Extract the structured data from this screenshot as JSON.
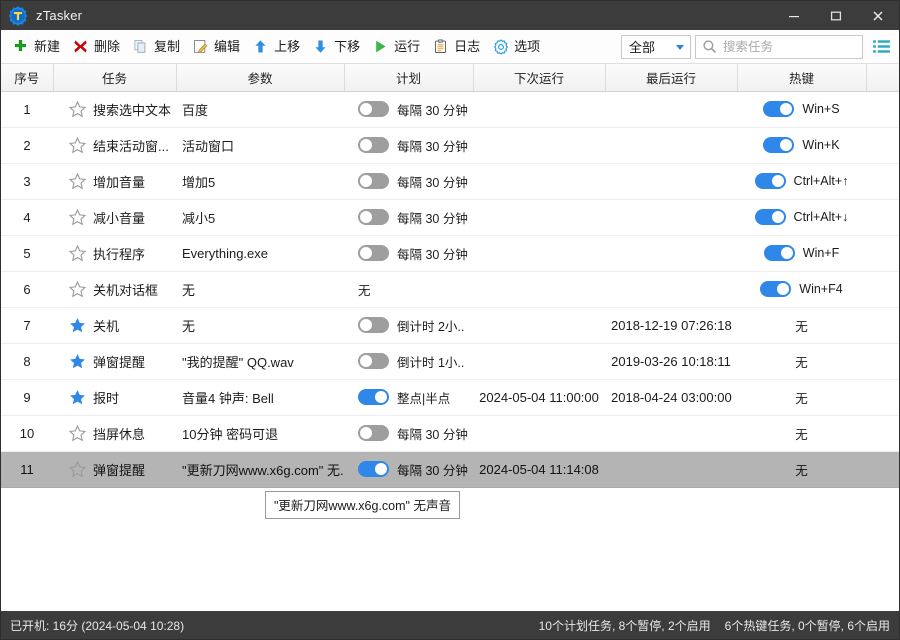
{
  "window": {
    "title": "zTasker",
    "app_icon": "gear-t-logo-icon",
    "minimize_label": "—",
    "maximize_label": "☐",
    "close_label": "✕"
  },
  "toolbar": {
    "items": [
      {
        "label": "新建",
        "icon": "plus-icon"
      },
      {
        "label": "删除",
        "icon": "delete-x-icon"
      },
      {
        "label": "复制",
        "icon": "copy-icon"
      },
      {
        "label": "编辑",
        "icon": "edit-pencil-icon"
      },
      {
        "label": "上移",
        "icon": "arrow-up-icon"
      },
      {
        "label": "下移",
        "icon": "arrow-down-icon"
      },
      {
        "label": "运行",
        "icon": "play-icon"
      },
      {
        "label": "日志",
        "icon": "clipboard-icon"
      },
      {
        "label": "选项",
        "icon": "gear-icon"
      }
    ],
    "filter": {
      "value": "全部",
      "icon": "chevron-down-icon"
    },
    "search": {
      "value": "",
      "placeholder": "搜索任务",
      "icon": "search-icon"
    },
    "list_view": {
      "icon": "list-view-icon"
    }
  },
  "table": {
    "columns": [
      "序号",
      "任务",
      "参数",
      "计划",
      "下次运行",
      "最后运行",
      "热键"
    ],
    "rows": [
      {
        "idx": "1",
        "star": "outline",
        "task": "搜索选中文本",
        "args": "百度",
        "plan_toggle": "off",
        "plan": "每隔 30 分钟",
        "next": "",
        "last": "",
        "hot_toggle": "on",
        "hotkey": "Win+S"
      },
      {
        "idx": "2",
        "star": "outline",
        "task": "结束活动窗...",
        "args": "活动窗口",
        "plan_toggle": "off",
        "plan": "每隔 30 分钟",
        "next": "",
        "last": "",
        "hot_toggle": "on",
        "hotkey": "Win+K"
      },
      {
        "idx": "3",
        "star": "outline",
        "task": "增加音量",
        "args": "增加5",
        "plan_toggle": "off",
        "plan": "每隔 30 分钟",
        "next": "",
        "last": "",
        "hot_toggle": "on",
        "hotkey": "Ctrl+Alt+↑"
      },
      {
        "idx": "4",
        "star": "outline",
        "task": "减小音量",
        "args": "减小5",
        "plan_toggle": "off",
        "plan": "每隔 30 分钟",
        "next": "",
        "last": "",
        "hot_toggle": "on",
        "hotkey": "Ctrl+Alt+↓"
      },
      {
        "idx": "5",
        "star": "outline",
        "task": "执行程序",
        "args": "Everything.exe",
        "plan_toggle": "off",
        "plan": "每隔 30 分钟",
        "next": "",
        "last": "",
        "hot_toggle": "on",
        "hotkey": "Win+F"
      },
      {
        "idx": "6",
        "star": "outline",
        "task": "关机对话框",
        "args": "无",
        "plan_toggle": "none",
        "plan": "无",
        "next": "",
        "last": "",
        "hot_toggle": "on",
        "hotkey": "Win+F4"
      },
      {
        "idx": "7",
        "star": "filled",
        "task": "关机",
        "args": "无",
        "plan_toggle": "off",
        "plan": "倒计时 2小..",
        "next": "",
        "last": "2018-12-19 07:26:18",
        "hot_toggle": "none",
        "hotkey": "无"
      },
      {
        "idx": "8",
        "star": "filled",
        "task": "弹窗提醒",
        "args": "\"我的提醒\" QQ.wav",
        "plan_toggle": "off",
        "plan": "倒计时 1小..",
        "next": "",
        "last": "2019-03-26 10:18:11",
        "hot_toggle": "none",
        "hotkey": "无"
      },
      {
        "idx": "9",
        "star": "filled",
        "task": "报时",
        "args": "音量4 钟声: Bell",
        "plan_toggle": "on",
        "plan": "整点|半点",
        "next": "2024-05-04 11:00:00",
        "last": "2018-04-24 03:00:00",
        "hot_toggle": "none",
        "hotkey": "无"
      },
      {
        "idx": "10",
        "star": "outline",
        "task": "挡屏休息",
        "args": "10分钟 密码可退",
        "plan_toggle": "off",
        "plan": "每隔 30 分钟",
        "next": "",
        "last": "",
        "hot_toggle": "none",
        "hotkey": "无"
      },
      {
        "idx": "11",
        "star": "outline",
        "task": "弹窗提醒",
        "args": "\"更新刀网www.x6g.com\" 无...",
        "plan_toggle": "on",
        "plan": "每隔 30 分钟",
        "next": "2024-05-04 11:14:08",
        "last": "",
        "hot_toggle": "none",
        "hotkey": "无",
        "selected": true
      }
    ]
  },
  "tooltip": {
    "text": "\"更新刀网www.x6g.com\" 无声音"
  },
  "statusbar": {
    "left": "已开机: 16分 (2024-05-04 10:28)",
    "right_plan": "10个计划任务, 8个暂停, 2个启用",
    "right_hotkey": "6个热键任务, 0个暂停, 6个启用"
  },
  "colors": {
    "titlebar": "#3c3c3c",
    "accent_blue": "#2f88e8",
    "toggle_off": "#9e9e9e",
    "selected_row": "#b4b4b4",
    "star_filled": "#2f88e8"
  }
}
